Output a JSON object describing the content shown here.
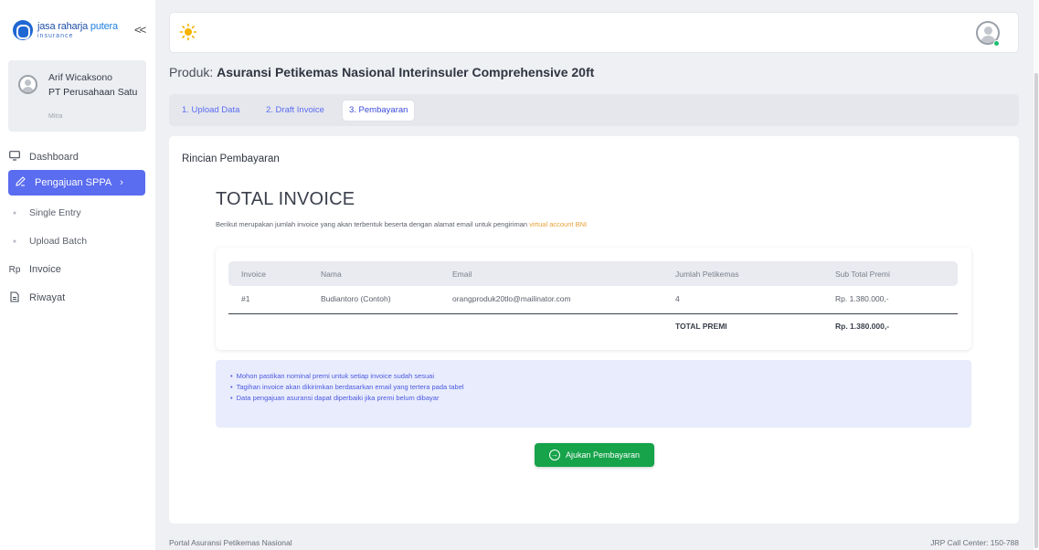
{
  "brand": {
    "name_part1": "jasa raharja",
    "name_part2": " putera",
    "sub": "insurance",
    "collapse_label": "<<"
  },
  "user": {
    "name": "Arif Wicaksono",
    "company": "PT Perusahaan Satu",
    "role": "Mitra"
  },
  "sidebar": {
    "items": [
      {
        "label": "Dashboard",
        "icon": "monitor-icon"
      },
      {
        "label": "Pengajuan SPPA",
        "icon": "pencil-icon",
        "active": true
      },
      {
        "label": "Single Entry",
        "icon": "dot-icon"
      },
      {
        "label": "Upload Batch",
        "icon": "dot-icon"
      },
      {
        "label": "Invoice",
        "icon": "rupiah-icon",
        "icon_text": "Rp"
      },
      {
        "label": "Riwayat",
        "icon": "document-icon"
      }
    ]
  },
  "product": {
    "prefix": "Produk: ",
    "name": "Asuransi Petikemas Nasional Interinsuler Comprehensive 20ft"
  },
  "tabs": [
    {
      "label": "1. Upload Data"
    },
    {
      "label": "2. Draft Invoice"
    },
    {
      "label": "3. Pembayaran",
      "active": true
    }
  ],
  "main": {
    "section_title": "Rincian Pembayaran",
    "heading": "TOTAL INVOICE",
    "description": "Berikut merupakan jumlah invoice yang akan terbentuk beserta dengan alamat email untuk pengiriman ",
    "description_highlight": "virtual account BNI"
  },
  "table": {
    "headers": [
      "Invoice",
      "Nama",
      "Email",
      "Jumlah Petikemas",
      "Sub Total Premi"
    ],
    "rows": [
      [
        "#1",
        "Budiantoro (Contoh)",
        "orangproduk20tlo@mailinator.com",
        "4",
        "Rp. 1.380.000,-"
      ]
    ],
    "total_label": "TOTAL PREMI",
    "total_value": "Rp. 1.380.000,-"
  },
  "notes": [
    "Mohon pastikan nominal premi untuk setiap invoice sudah sesuai",
    "Tagihan invoice akan dikirimkan berdasarkan email yang tertera pada tabel",
    "Data pengajuan asuransi dapat diperbaiki jika premi belum dibayar"
  ],
  "submit_label": "Ajukan Pembayaran",
  "footer": {
    "left": "Portal Asuransi Petikemas Nasional",
    "right": "JRP Call Center: 150-788"
  },
  "colors": {
    "accent": "#5a6cf0",
    "success": "#16a34a",
    "highlight": "#e8a035"
  }
}
